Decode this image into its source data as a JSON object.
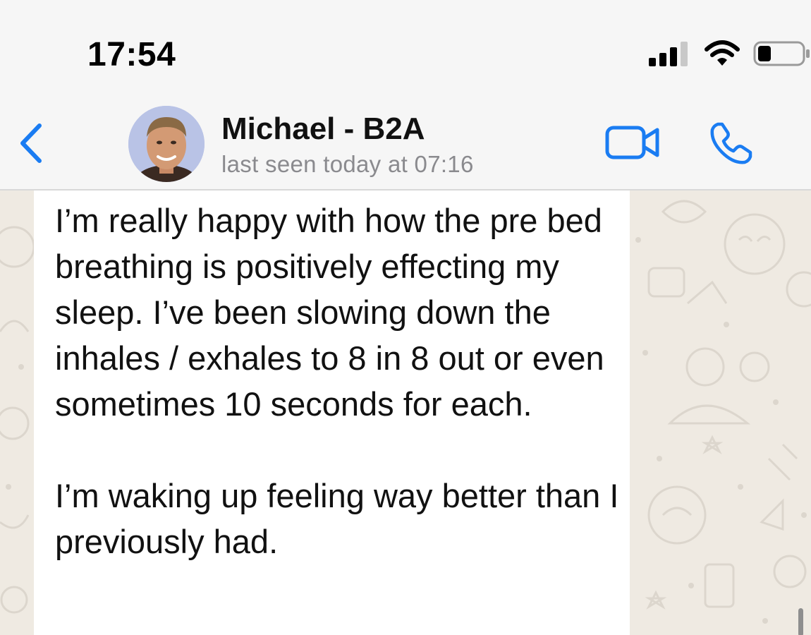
{
  "status_bar": {
    "time": "17:54",
    "icons": [
      "cellular-signal-icon",
      "wifi-icon",
      "battery-icon"
    ],
    "battery_level": 0.3
  },
  "header": {
    "back_icon": "chevron-left-icon",
    "contact_name": "Michael - B2A",
    "last_seen": "last seen today at 07:16",
    "video_icon": "video-camera-icon",
    "call_icon": "phone-icon",
    "accent_color": "#1a7cf2"
  },
  "conversation": {
    "messages": [
      {
        "paragraphs": [
          "I’m really happy with how the pre bed breathing is positively effecting my sleep. I’ve been slowing down the inhales / exhales to 8 in 8 out or even sometimes 10 seconds for each.",
          "I’m waking up feeling way better than I previously had."
        ]
      }
    ]
  }
}
